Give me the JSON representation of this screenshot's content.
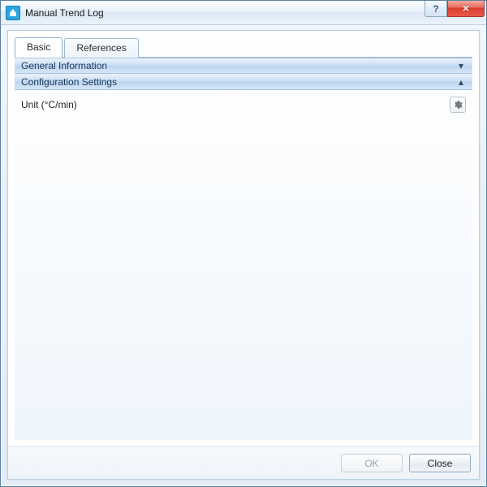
{
  "window": {
    "title": "Manual Trend Log"
  },
  "tabs": [
    {
      "label": "Basic",
      "active": true
    },
    {
      "label": "References",
      "active": false
    }
  ],
  "sections": {
    "general": {
      "title": "General Information",
      "expanded": false
    },
    "config": {
      "title": "Configuration Settings",
      "expanded": true,
      "rows": [
        {
          "name": "Unit (°C/min)"
        }
      ]
    }
  },
  "buttons": {
    "ok": "OK",
    "close": "Close"
  }
}
